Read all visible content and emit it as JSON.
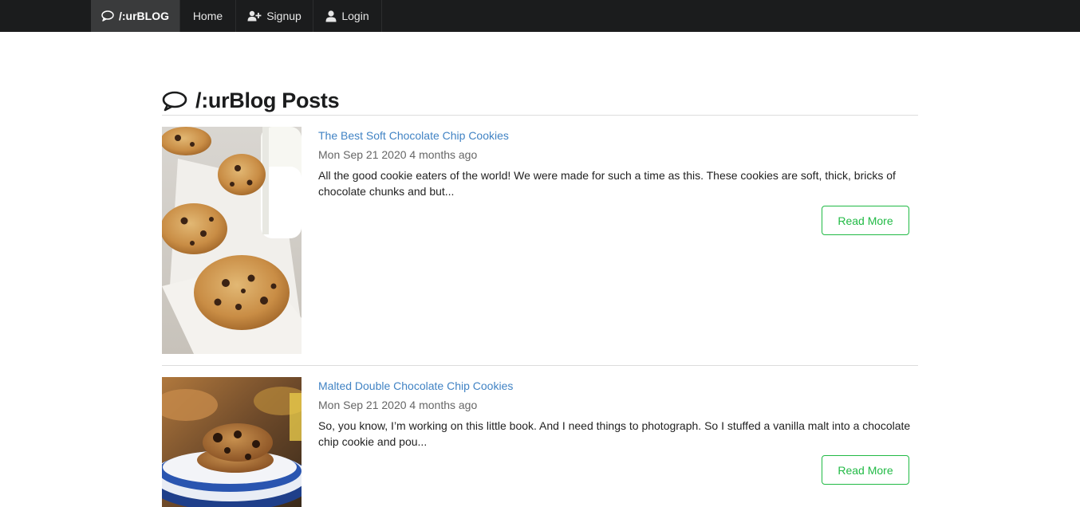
{
  "nav": {
    "brand": "/:urBLOG",
    "home": "Home",
    "signup": "Signup",
    "login": "Login"
  },
  "page": {
    "title": "/:urBlog Posts"
  },
  "posts": [
    {
      "title": "The Best Soft Chocolate Chip Cookies",
      "meta": "Mon Sep 21 2020 4 months ago",
      "excerpt": "All the good cookie eaters of the world! We were made for such a time as this. These cookies are soft, thick, bricks of chocolate chunks and but...",
      "button": "Read More"
    },
    {
      "title": "Malted Double Chocolate Chip Cookies",
      "meta": "Mon Sep 21 2020 4 months ago",
      "excerpt": "So, you know, I’m working on this little book. And I need things to photograph. So I stuffed a vanilla malt into a chocolate chip cookie and pou...",
      "button": "Read More"
    }
  ],
  "colors": {
    "navbar": "#1b1c1d",
    "link": "#4183c4",
    "accent": "#21ba45"
  },
  "icons": {
    "brand": "speech-bubble-icon",
    "signup": "user-plus-icon",
    "login": "user-icon",
    "header": "speech-bubble-icon"
  }
}
